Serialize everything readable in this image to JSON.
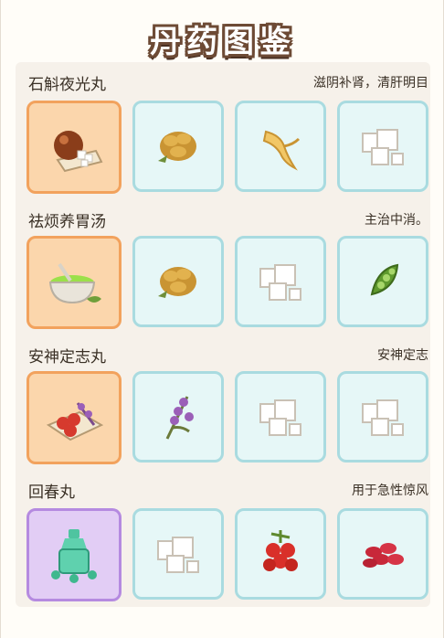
{
  "title": "丹药图鉴",
  "recipes": [
    {
      "name": "石斛夜光丸",
      "desc": "滋阴补肾，清肝明目",
      "product_icon": "pill-pot-icon",
      "ingredients": [
        "ginger-root-icon",
        "ginseng-root-icon",
        "white-cubes-icon"
      ]
    },
    {
      "name": "祛烦养胃汤",
      "desc": "主治中消。",
      "product_icon": "green-soup-bowl-icon",
      "ingredients": [
        "ginger-root-icon",
        "white-cubes-icon",
        "green-pod-icon"
      ]
    },
    {
      "name": "安神定志丸",
      "desc": "安神定志",
      "product_icon": "red-berries-plate-icon",
      "ingredients": [
        "purple-herb-icon",
        "white-cubes-icon",
        "white-cubes-icon"
      ]
    },
    {
      "name": "回春丸",
      "desc": "用于急性惊风",
      "product_icon": "green-bottle-icon",
      "ingredients": [
        "white-cubes-icon",
        "red-berry-cluster-icon",
        "red-beans-icon"
      ]
    }
  ],
  "colors": {
    "product_frame": "#f2a25d",
    "product_frame_purple": "#b58ae0",
    "ingredient_frame": "#a9dbe0"
  }
}
